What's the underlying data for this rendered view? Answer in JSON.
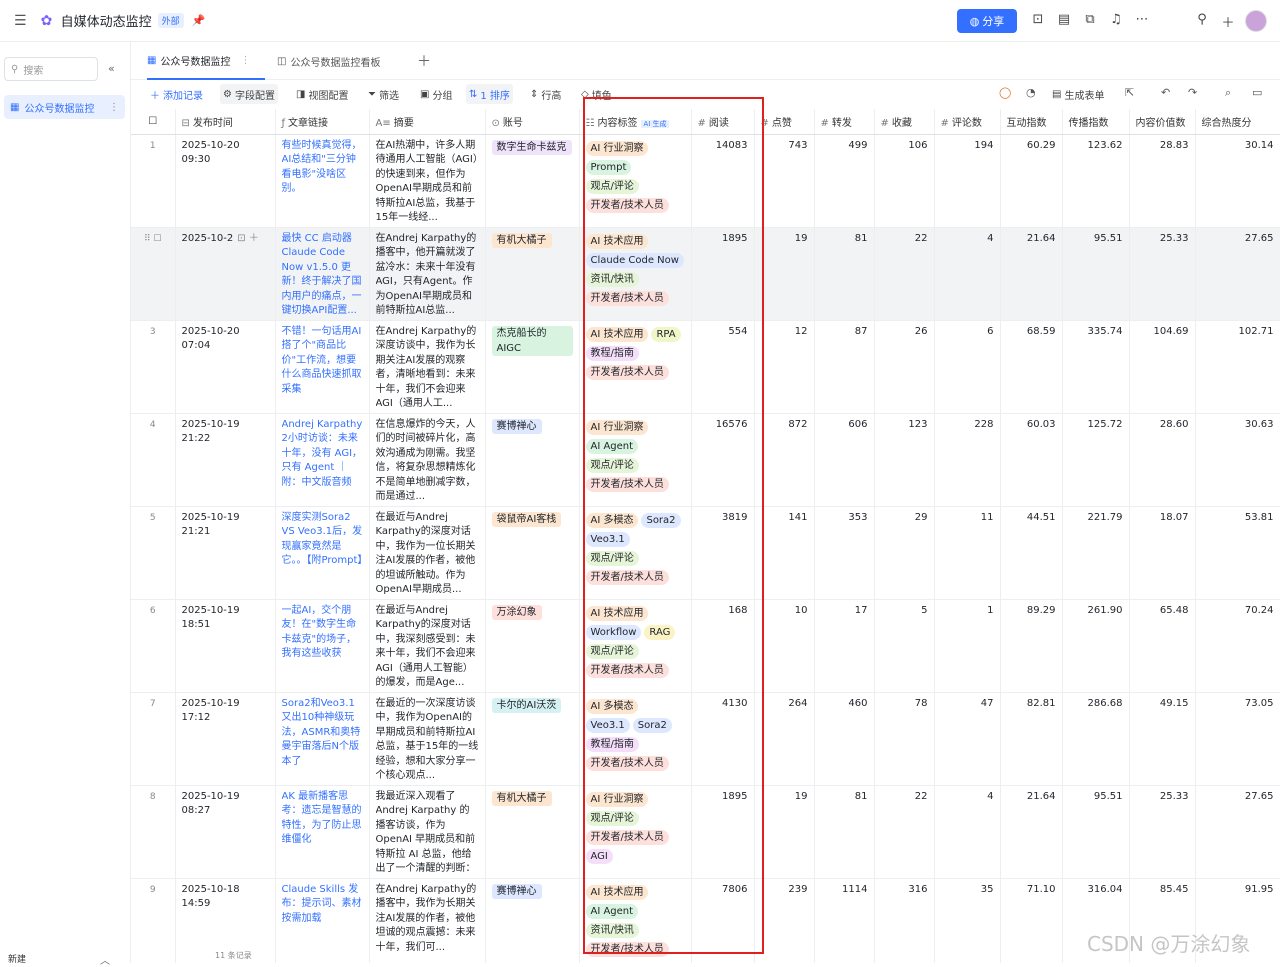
{
  "app": {
    "title": "自媒体动态监控",
    "tag": "外部",
    "share_label": "分享"
  },
  "sidebar": {
    "search_placeholder": "搜索",
    "items": [
      {
        "label": "公众号数据监控"
      }
    ],
    "new_label": "新建"
  },
  "tabs": [
    {
      "label": "公众号数据监控"
    },
    {
      "label": "公众号数据监控看板"
    }
  ],
  "toolbar": {
    "add": "添加记录",
    "fields": "字段配置",
    "view": "视图配置",
    "filter": "筛选",
    "group": "分组",
    "sort": "1 排序",
    "rowheight": "行高",
    "fill": "填色",
    "form": "生成表单"
  },
  "columns": [
    "发布时间",
    "文章链接",
    "摘要",
    "账号",
    "内容标签",
    "阅读",
    "点赞",
    "转发",
    "收藏",
    "评论数",
    "互动指数",
    "传播指数",
    "内容价值数",
    "综合热度分"
  ],
  "ai_flag": "AI 生成",
  "rows": [
    {
      "idx": "1",
      "time": "2025-10-20 09:30",
      "link": "有些时候真觉得，AI总结和\"三分钟看电影\"没啥区别。",
      "summary": "在AI热潮中，许多人期待通用人工智能（AGI）的快速到来，但作为OpenAI早期成员和前特斯拉AI总监，我基于15年一线经...",
      "account": "数字生命卡兹克",
      "tags": [
        "AI 行业洞察",
        "Prompt",
        "观点/评论",
        "开发者/技术人员"
      ],
      "read": "14083",
      "like": "743",
      "share": "499",
      "fav": "106",
      "comment": "194",
      "interact": "60.29",
      "spread": "123.62",
      "value": "28.83",
      "heat": "30.14"
    },
    {
      "idx": "",
      "time": "2025-10-2",
      "link": "最快 CC 启动器 Claude Code Now v1.5.0 更新！终于解决了国内用户的痛点，一键切换API配置...",
      "summary": "在Andrej Karpathy的播客中，他开篇就泼了盆冷水：未来十年没有AGI，只有Agent。作为OpenAI早期成员和前特斯拉AI总监...",
      "account": "有机大橘子",
      "tags": [
        "AI 技术应用",
        "Claude Code Now",
        "资讯/快讯",
        "开发者/技术人员"
      ],
      "read": "1895",
      "like": "19",
      "share": "81",
      "fav": "22",
      "comment": "4",
      "interact": "21.64",
      "spread": "95.51",
      "value": "25.33",
      "heat": "27.65"
    },
    {
      "idx": "3",
      "time": "2025-10-20 07:04",
      "link": "不错！一句话用AI搭了个\"商品比价\"工作流，想要什么商品快速抓取采集",
      "summary": "在Andrej Karpathy的深度访谈中，我作为长期关注AI发展的观察者，清晰地看到：未来十年，我们不会迎来AGI（通用人工...",
      "account": "杰克船长的AIGC",
      "tags": [
        "AI 技术应用",
        "RPA",
        "教程/指南",
        "开发者/技术人员"
      ],
      "read": "554",
      "like": "12",
      "share": "87",
      "fav": "26",
      "comment": "6",
      "interact": "68.59",
      "spread": "335.74",
      "value": "104.69",
      "heat": "102.71"
    },
    {
      "idx": "4",
      "time": "2025-10-19 21:22",
      "link": "Andrej Karpathy 2小时访谈：未来十年，没有 AGI，只有 Agent ｜附：中文版音频",
      "summary": "在信息爆炸的今天，人们的时间被碎片化，高效沟通成为刚需。我坚信，将复杂思想精炼化不是简单地删减字数，而是通过...",
      "account": "赛博禅心",
      "tags": [
        "AI 行业洞察",
        "AI Agent",
        "观点/评论",
        "开发者/技术人员"
      ],
      "read": "16576",
      "like": "872",
      "share": "606",
      "fav": "123",
      "comment": "228",
      "interact": "60.03",
      "spread": "125.72",
      "value": "28.60",
      "heat": "30.63"
    },
    {
      "idx": "5",
      "time": "2025-10-19 21:21",
      "link": "深度实测Sora2 VS Veo3.1后，发现赢家竟然是它。。【附Prompt】",
      "summary": "在最近与Andrej Karpathy的深度对话中，我作为一位长期关注AI发展的作者，被他的坦诚所触动。作为OpenAI早期成员...",
      "account": "袋鼠帝AI客栈",
      "tags": [
        "AI 多模态",
        "Sora2",
        "Veo3.1",
        "观点/评论",
        "开发者/技术人员"
      ],
      "read": "3819",
      "like": "141",
      "share": "353",
      "fav": "29",
      "comment": "11",
      "interact": "44.51",
      "spread": "221.79",
      "value": "18.07",
      "heat": "53.81"
    },
    {
      "idx": "6",
      "time": "2025-10-19 18:51",
      "link": "一起AI，交个朋友！在\"数字生命卡兹克\"的场子，我有这些收获",
      "summary": "在最近与Andrej Karpathy的深度对话中，我深刻感受到：未来十年，我们不会迎来AGI（通用人工智能）的爆发，而是Age...",
      "account": "万涂幻象",
      "tags": [
        "AI 技术应用",
        "Workflow",
        "RAG",
        "观点/评论",
        "开发者/技术人员"
      ],
      "read": "168",
      "like": "10",
      "share": "17",
      "fav": "5",
      "comment": "1",
      "interact": "89.29",
      "spread": "261.90",
      "value": "65.48",
      "heat": "70.24"
    },
    {
      "idx": "7",
      "time": "2025-10-19 17:12",
      "link": "Sora2和Veo3.1又出10种神级玩法，ASMR和奥特曼宇宙落后N个版本了",
      "summary": "在最近的一次深度访谈中，我作为OpenAI的早期成员和前特斯拉AI总监，基于15年的一线经验，想和大家分享一个核心观点...",
      "account": "卡尔的AI沃茨",
      "tags": [
        "AI 多模态",
        "Veo3.1",
        "Sora2",
        "教程/指南",
        "开发者/技术人员"
      ],
      "read": "4130",
      "like": "264",
      "share": "460",
      "fav": "78",
      "comment": "47",
      "interact": "82.81",
      "spread": "286.68",
      "value": "49.15",
      "heat": "73.05"
    },
    {
      "idx": "8",
      "time": "2025-10-19 08:27",
      "link": "AK 最新播客思考：遗忘是智慧的特性，为了防止思维僵化",
      "summary": "我最近深入观看了Andrej Karpathy 的播客访谈，作为 OpenAI 早期成员和前特斯拉 AI 总监，他给出了一个清醒的判断：未来...",
      "account": "有机大橘子",
      "tags": [
        "AI 行业洞察",
        "观点/评论",
        "开发者/技术人员",
        "AGI"
      ],
      "read": "1895",
      "like": "19",
      "share": "81",
      "fav": "22",
      "comment": "4",
      "interact": "21.64",
      "spread": "95.51",
      "value": "25.33",
      "heat": "27.65"
    },
    {
      "idx": "9",
      "time": "2025-10-18 14:59",
      "link": "Claude Skills 发布：提示词、素材按需加载",
      "summary": "在Andrej Karpathy的播客中，我作为长期关注AI发展的作者，被他坦诚的观点震撼：未来十年，我们可...",
      "account": "赛博禅心",
      "tags": [
        "AI 技术应用",
        "AI Agent",
        "资讯/快讯",
        "开发者/技术人员"
      ],
      "read": "7806",
      "like": "239",
      "share": "1114",
      "fav": "316",
      "comment": "35",
      "interact": "71.10",
      "spread": "316.04",
      "value": "85.45",
      "heat": "91.95"
    }
  ],
  "footer": {
    "count": "11 条记录"
  },
  "watermark": "CSDN @万涂幻象",
  "colors": {
    "accent": "#3370ff",
    "highlight_box": "#e0201f"
  }
}
